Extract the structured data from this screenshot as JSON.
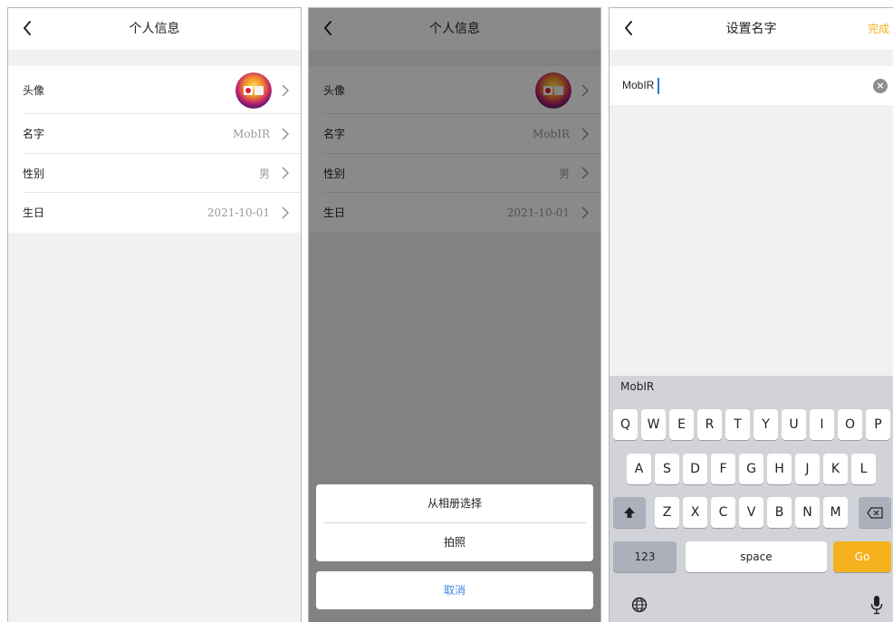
{
  "screens": {
    "profile": {
      "title": "个人信息",
      "rows": [
        {
          "label": "头像",
          "value": ""
        },
        {
          "label": "名字",
          "value": "MobIR"
        },
        {
          "label": "性别",
          "value": "男"
        },
        {
          "label": "生日",
          "value": "2021-10-01"
        }
      ]
    },
    "photo_sheet": {
      "title": "个人信息",
      "rows": [
        {
          "label": "头像",
          "value": ""
        },
        {
          "label": "名字",
          "value": "MobIR"
        },
        {
          "label": "性别",
          "value": "男"
        },
        {
          "label": "生日",
          "value": "2021-10-01"
        }
      ],
      "options": [
        "从相册选择",
        "拍照"
      ],
      "cancel": "取消"
    },
    "set_name": {
      "title": "设置名字",
      "done": "完成",
      "input_value": "MobIR",
      "clear_icon": "×",
      "keyboard": {
        "suggestion": "MobIR",
        "row1": [
          "Q",
          "W",
          "E",
          "R",
          "T",
          "Y",
          "U",
          "I",
          "O",
          "P"
        ],
        "row2": [
          "A",
          "S",
          "D",
          "F",
          "G",
          "H",
          "J",
          "K",
          "L"
        ],
        "row3": [
          "Z",
          "X",
          "C",
          "V",
          "B",
          "N",
          "M"
        ],
        "numbers_key": "123",
        "space_key": "space",
        "go_key": "Go",
        "shift_icon": "shift-icon",
        "delete_icon": "backspace-icon",
        "globe_icon": "globe-icon",
        "mic_icon": "microphone-icon"
      }
    }
  },
  "colors": {
    "accent": "#f5b21d",
    "link_blue": "#3a86e0",
    "background": "#f1f1f3",
    "keyboard_bg": "#d1d3d9"
  }
}
